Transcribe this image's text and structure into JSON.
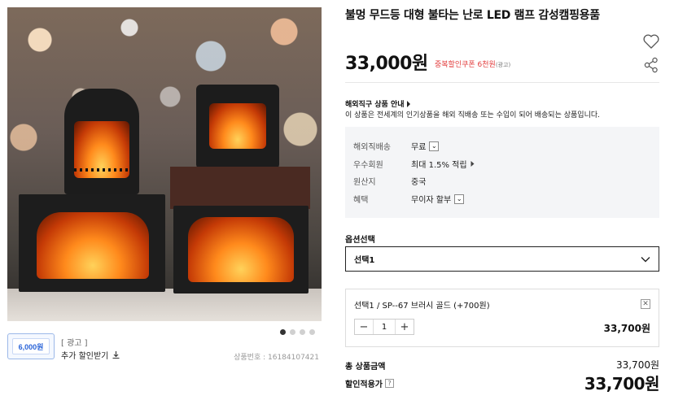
{
  "product": {
    "title": "불멍 무드등 대형 불타는 난로 LED 램프 감성캠핑용품",
    "price": "33,000원",
    "coupon_text": "중복할인쿠폰 6천원",
    "coupon_ad_tag": "(광고)",
    "product_number": "상품번호 : 16184107421",
    "image_alt": "fireplace-lantern-photo"
  },
  "ad": {
    "label": "[ 광고 ]",
    "coupon_link": "추가 할인받기",
    "thumb_text": "6,000원"
  },
  "carousel": {
    "total": 4,
    "active_index": 0
  },
  "direct": {
    "title": "해외직구 상품 안내",
    "description": "이 상품은 전세계의 인기상품을 해외 직배송 또는 수입이 되어 배송되는 상품입니다."
  },
  "info": {
    "rows": [
      {
        "key": "해외직배송",
        "value": "무료"
      },
      {
        "key": "우수회원",
        "value": "최대 1.5% 적립"
      },
      {
        "key": "원산지",
        "value": "중국"
      },
      {
        "key": "혜택",
        "value": "무이자 할부"
      }
    ]
  },
  "options": {
    "label": "옵션선택",
    "selected_value": "선택1"
  },
  "selection": {
    "name": "선택1 / SP--67 브러시 골드 (+700원)",
    "quantity": "1",
    "price": "33,700원"
  },
  "totals": {
    "total_label": "총 상품금액",
    "total_value": "33,700원",
    "final_label": "할인적용가",
    "final_value": "33,700원"
  },
  "icons": {
    "wish": "heart-icon",
    "share": "share-icon",
    "download": "download-icon",
    "remove": "close-icon",
    "help": "question-icon"
  }
}
